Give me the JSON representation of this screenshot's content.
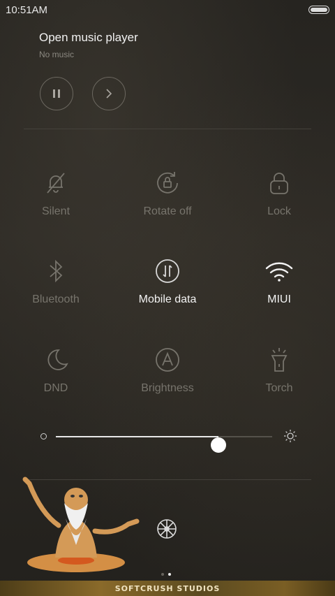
{
  "status_bar": {
    "time": "10:51AM",
    "battery_icon": "battery-icon"
  },
  "music": {
    "title": "Open music player",
    "subtitle": "No music",
    "pause_icon": "pause-icon",
    "next_icon": "next-icon"
  },
  "toggles": [
    {
      "label": "Silent",
      "icon": "bell-off-icon",
      "active": false
    },
    {
      "label": "Rotate off",
      "icon": "rotate-lock-icon",
      "active": false
    },
    {
      "label": "Lock",
      "icon": "lock-icon",
      "active": false
    },
    {
      "label": "Bluetooth",
      "icon": "bluetooth-icon",
      "active": false
    },
    {
      "label": "Mobile data",
      "icon": "mobile-data-icon",
      "active": true
    },
    {
      "label": "MIUI",
      "icon": "wifi-icon",
      "active": true
    },
    {
      "label": "DND",
      "icon": "moon-icon",
      "active": false
    },
    {
      "label": "Brightness",
      "icon": "auto-brightness-icon",
      "active": false
    },
    {
      "label": "Torch",
      "icon": "torch-icon",
      "active": false
    }
  ],
  "brightness": {
    "level": 0.75
  },
  "pager": {
    "pages": 2,
    "current": 2
  },
  "footer": {
    "brand": "SOFTCRUSH STUDIOS"
  }
}
